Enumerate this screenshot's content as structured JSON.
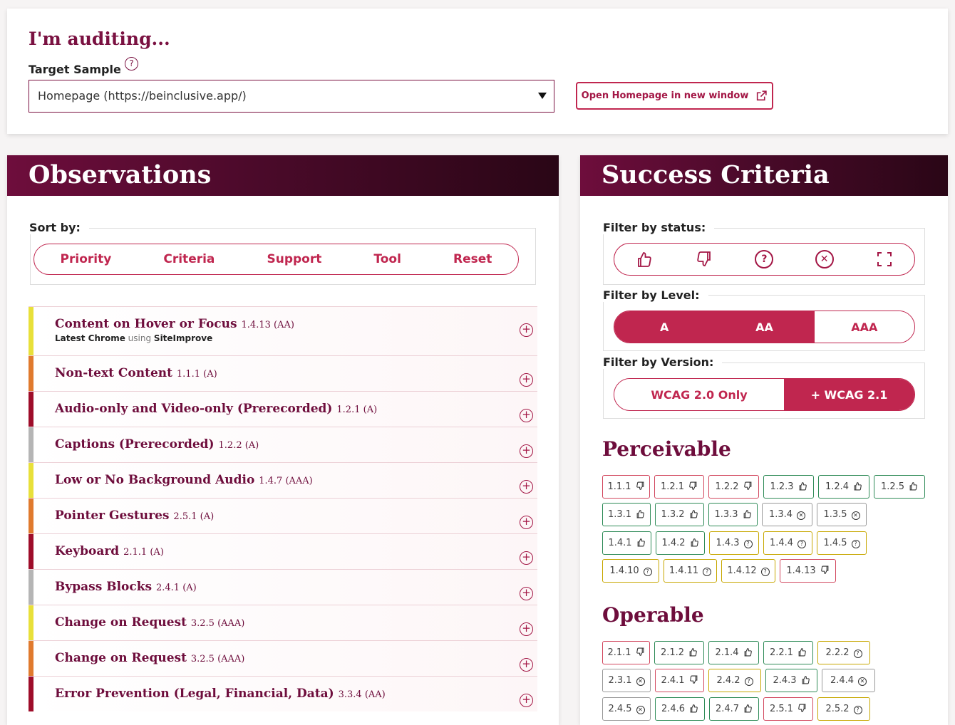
{
  "audit": {
    "title": "I'm auditing...",
    "target_label": "Target Sample",
    "target_value": "Homepage (https://beinclusive.app/)",
    "open_button": "Open Homepage in new window"
  },
  "observations": {
    "header": "Observations",
    "sort_label": "Sort by:",
    "sort_options": [
      "Priority",
      "Criteria",
      "Support",
      "Tool",
      "Reset"
    ],
    "items": [
      {
        "title": "Content on Hover or Focus",
        "ref": "1.4.13 (AA)",
        "sub_browser": "Latest Chrome",
        "sub_using": "using",
        "sub_tool": "SiteImprove",
        "color": "#e8e03a"
      },
      {
        "title": "Non-text Content",
        "ref": "1.1.1 (A)",
        "color": "#e07a2e"
      },
      {
        "title": "Audio-only and Video-only (Prerecorded)",
        "ref": "1.2.1 (A)",
        "color": "#9e0d2a"
      },
      {
        "title": "Captions (Prerecorded)",
        "ref": "1.2.2 (A)",
        "color": "#b5b5b5"
      },
      {
        "title": "Low or No Background Audio",
        "ref": "1.4.7 (AAA)",
        "color": "#e8e03a"
      },
      {
        "title": "Pointer Gestures",
        "ref": "2.5.1 (A)",
        "color": "#e07a2e"
      },
      {
        "title": "Keyboard",
        "ref": "2.1.1 (A)",
        "color": "#9e0d2a"
      },
      {
        "title": "Bypass Blocks",
        "ref": "2.4.1 (A)",
        "color": "#b5b5b5"
      },
      {
        "title": "Change on Request",
        "ref": "3.2.5 (AAA)",
        "color": "#e8e03a"
      },
      {
        "title": "Change on Request",
        "ref": "3.2.5 (AAA)",
        "color": "#e07a2e"
      },
      {
        "title": "Error Prevention (Legal, Financial, Data)",
        "ref": "3.3.4 (AA)",
        "color": "#9e0d2a"
      }
    ]
  },
  "criteria": {
    "header": "Success Criteria",
    "filter_status_label": "Filter by status:",
    "filter_level_label": "Filter by Level:",
    "levels": [
      "A",
      "AA",
      "AAA"
    ],
    "filter_version_label": "Filter by Version:",
    "versions": [
      "WCAG 2.0 Only",
      "+ WCAG 2.1"
    ],
    "perceivable_title": "Perceivable",
    "operable_title": "Operable",
    "perceivable": [
      {
        "id": "1.1.1",
        "status": "fail"
      },
      {
        "id": "1.2.1",
        "status": "fail"
      },
      {
        "id": "1.2.2",
        "status": "fail"
      },
      {
        "id": "1.2.3",
        "status": "pass"
      },
      {
        "id": "1.2.4",
        "status": "pass"
      },
      {
        "id": "1.2.5",
        "status": "pass"
      },
      {
        "id": "1.3.1",
        "status": "pass"
      },
      {
        "id": "1.3.2",
        "status": "pass"
      },
      {
        "id": "1.3.3",
        "status": "pass"
      },
      {
        "id": "1.3.4",
        "status": "na"
      },
      {
        "id": "1.3.5",
        "status": "na"
      },
      {
        "id": "1.4.1",
        "status": "pass"
      },
      {
        "id": "1.4.2",
        "status": "pass"
      },
      {
        "id": "1.4.3",
        "status": "tbd"
      },
      {
        "id": "1.4.4",
        "status": "tbd"
      },
      {
        "id": "1.4.5",
        "status": "tbd"
      },
      {
        "id": "1.4.10",
        "status": "tbd"
      },
      {
        "id": "1.4.11",
        "status": "tbd"
      },
      {
        "id": "1.4.12",
        "status": "tbd"
      },
      {
        "id": "1.4.13",
        "status": "fail"
      }
    ],
    "operable": [
      {
        "id": "2.1.1",
        "status": "fail"
      },
      {
        "id": "2.1.2",
        "status": "pass"
      },
      {
        "id": "2.1.4",
        "status": "pass"
      },
      {
        "id": "2.2.1",
        "status": "pass"
      },
      {
        "id": "2.2.2",
        "status": "tbd"
      },
      {
        "id": "2.3.1",
        "status": "na"
      },
      {
        "id": "2.4.1",
        "status": "fail"
      },
      {
        "id": "2.4.2",
        "status": "tbd"
      },
      {
        "id": "2.4.3",
        "status": "pass"
      },
      {
        "id": "2.4.4",
        "status": "na"
      },
      {
        "id": "2.4.5",
        "status": "na"
      },
      {
        "id": "2.4.6",
        "status": "pass"
      },
      {
        "id": "2.4.7",
        "status": "pass"
      },
      {
        "id": "2.5.1",
        "status": "fail"
      },
      {
        "id": "2.5.2",
        "status": "tbd"
      }
    ]
  }
}
